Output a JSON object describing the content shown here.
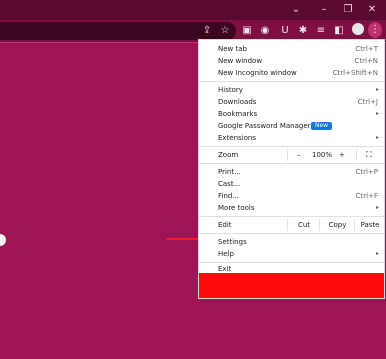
{
  "window": {
    "chevron": "⌄",
    "minimize": "–",
    "restore": "❐",
    "close": "✕"
  },
  "toolbar": {
    "share_icon": "⇪",
    "star_icon": "☆",
    "ext1_icon": "▣",
    "ext2_icon": "◉",
    "ext3_icon": "U",
    "puzzle_icon": "✱",
    "playlist_icon": "≡",
    "sidebar_icon": "◧",
    "kebab_icon": "⋮"
  },
  "menu": {
    "new_tab": {
      "label": "New tab",
      "shortcut": "Ctrl+T"
    },
    "new_window": {
      "label": "New window",
      "shortcut": "Ctrl+N"
    },
    "new_incognito": {
      "label": "New Incognito window",
      "shortcut": "Ctrl+Shift+N"
    },
    "history": {
      "label": "History",
      "arrow": "▸"
    },
    "downloads": {
      "label": "Downloads",
      "shortcut": "Ctrl+J"
    },
    "bookmarks": {
      "label": "Bookmarks",
      "arrow": "▸"
    },
    "password_manager": {
      "label": "Google Password Manager",
      "badge": "New"
    },
    "extensions": {
      "label": "Extensions",
      "arrow": "▸"
    },
    "zoom": {
      "label": "Zoom",
      "minus": "–",
      "value": "100%",
      "plus": "+",
      "fullscreen": "⛶"
    },
    "print": {
      "label": "Print...",
      "shortcut": "Ctrl+P"
    },
    "cast": {
      "label": "Cast..."
    },
    "find": {
      "label": "Find...",
      "shortcut": "Ctrl+F"
    },
    "more_tools": {
      "label": "More tools",
      "arrow": "▸"
    },
    "edit": {
      "label": "Edit",
      "cut": "Cut",
      "copy": "Copy",
      "paste": "Paste"
    },
    "settings": {
      "label": "Settings"
    },
    "help": {
      "label": "Help",
      "arrow": "▸"
    },
    "exit": {
      "label": "Exit"
    }
  },
  "colors": {
    "page_bg": "#9e1555",
    "highlight_box": "#ff0a0a",
    "arrow": "#ff1a1a",
    "badge": "#1a73e8"
  }
}
